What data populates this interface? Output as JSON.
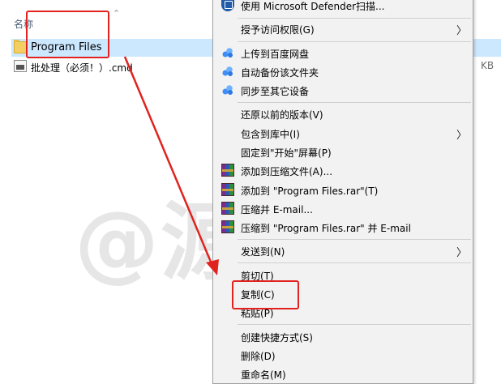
{
  "explorer": {
    "column_name_header": "名称",
    "files": [
      {
        "name": "Program Files",
        "icon": "folder-icon",
        "selected": true
      },
      {
        "name": "批处理（必须！）.cmd",
        "icon": "cmd-file-icon",
        "selected": false
      }
    ],
    "size_tail": "KB"
  },
  "context_menu": {
    "items": [
      {
        "label": "使用 Microsoft Defender扫描...",
        "icon": "defender-shield-icon"
      },
      {
        "label": "授予访问权限(G)",
        "submenu": true
      },
      {
        "label": "上传到百度网盘",
        "icon": "baidu-cloud-icon"
      },
      {
        "label": "自动备份该文件夹",
        "icon": "baidu-cloud-icon"
      },
      {
        "label": "同步至其它设备",
        "icon": "baidu-cloud-icon"
      },
      {
        "label": "还原以前的版本(V)"
      },
      {
        "label": "包含到库中(I)",
        "submenu": true
      },
      {
        "label": "固定到\"开始\"屏幕(P)"
      },
      {
        "label": "添加到压缩文件(A)...",
        "icon": "winrar-icon"
      },
      {
        "label": "添加到 \"Program Files.rar\"(T)",
        "icon": "winrar-icon"
      },
      {
        "label": "压缩并 E-mail...",
        "icon": "winrar-icon"
      },
      {
        "label": "压缩到 \"Program Files.rar\" 并 E-mail",
        "icon": "winrar-icon"
      },
      {
        "label": "发送到(N)",
        "submenu": true
      },
      {
        "label": "剪切(T)"
      },
      {
        "label": "复制(C)"
      },
      {
        "label": "粘贴(P)"
      },
      {
        "label": "创建快捷方式(S)"
      },
      {
        "label": "删除(D)"
      },
      {
        "label": "重命名(M)"
      }
    ]
  },
  "annotation": {
    "color": "#e0231f",
    "watermark": "@源于风"
  }
}
